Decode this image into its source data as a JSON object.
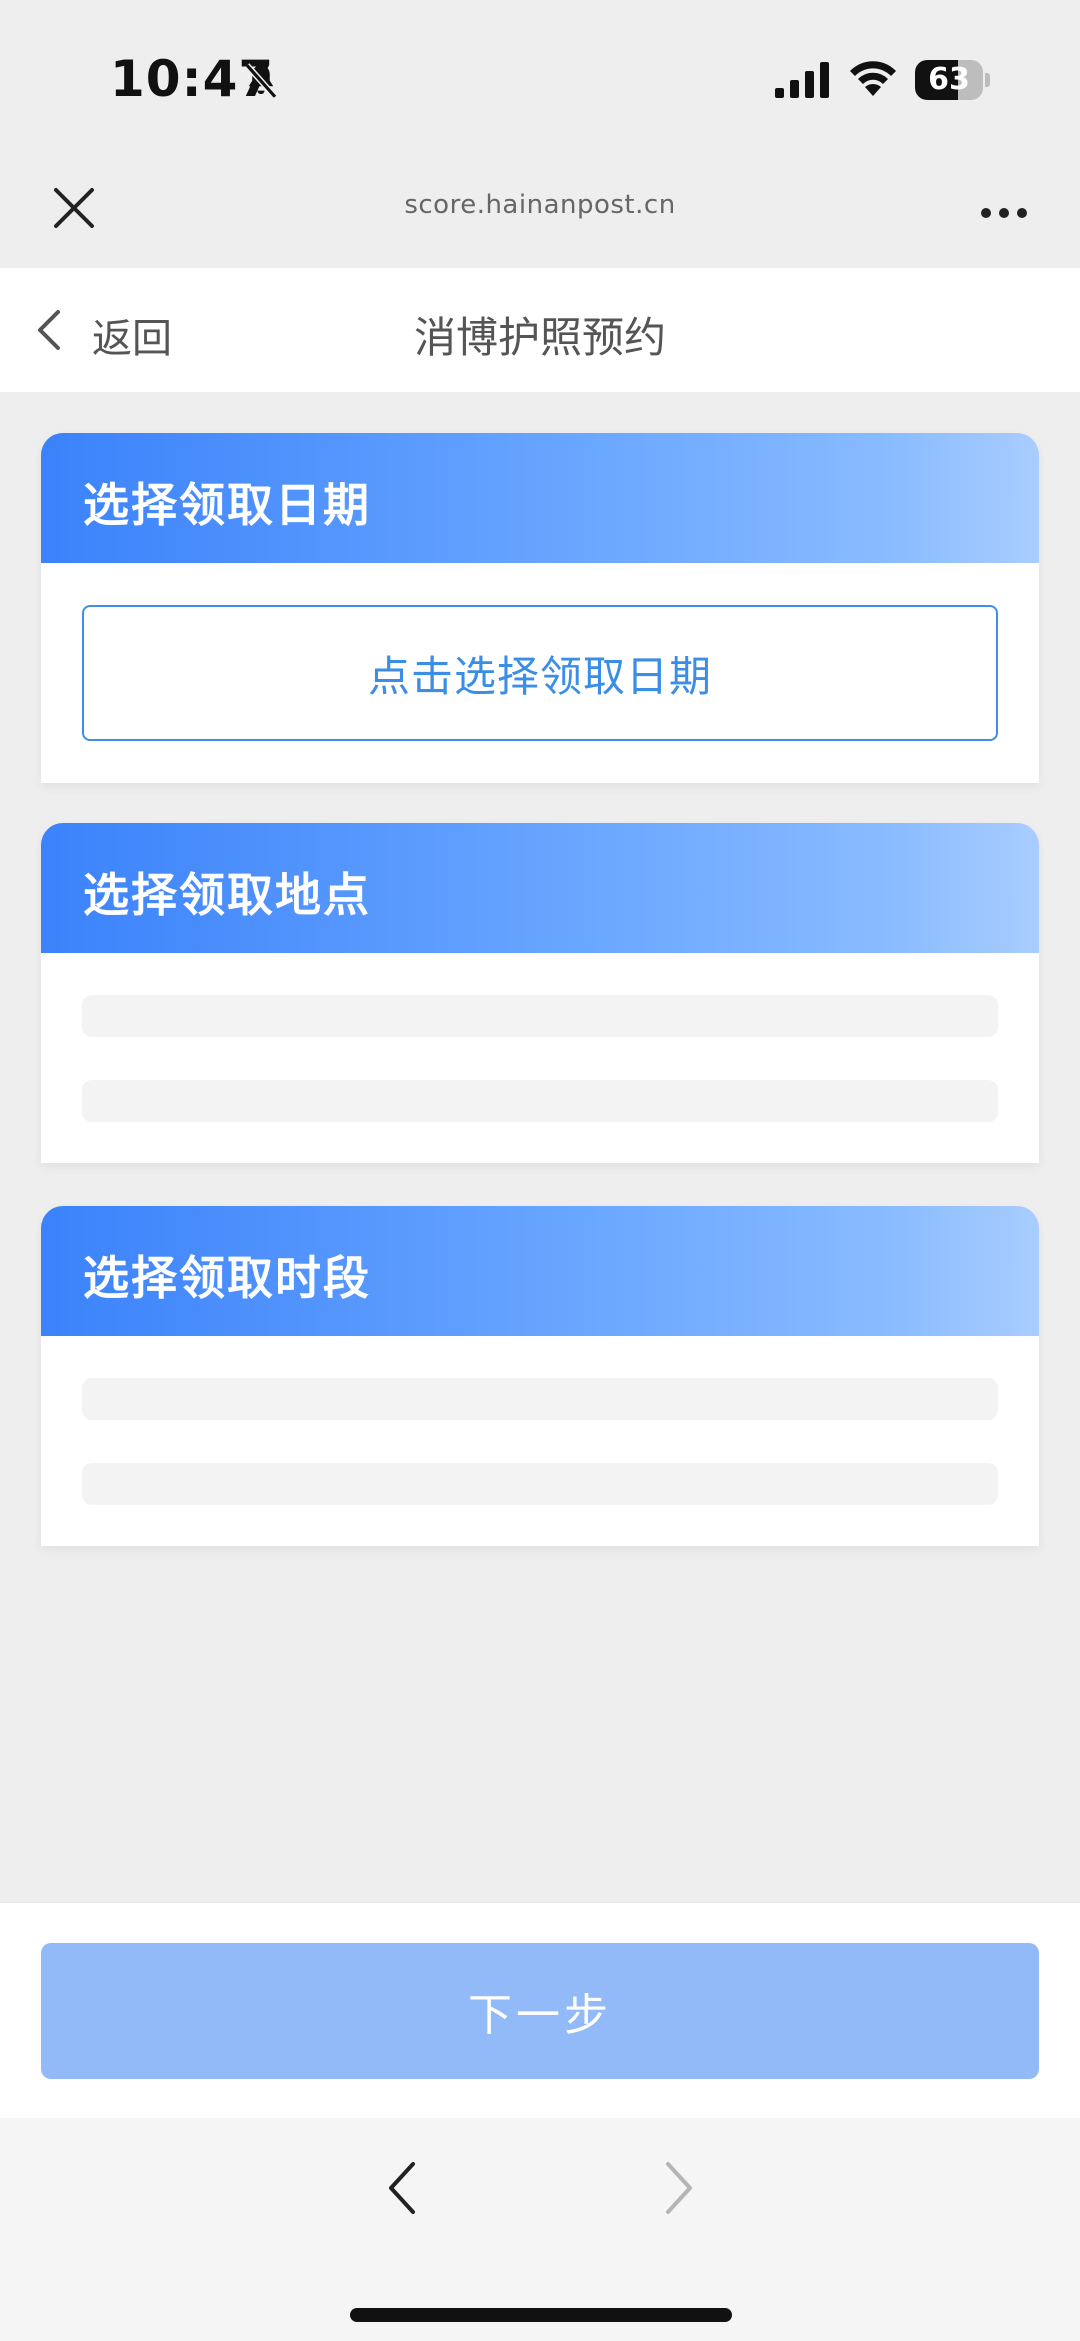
{
  "status_bar": {
    "time": "10:47",
    "battery_level": "63",
    "battery_fraction": 0.63,
    "icons": [
      "bell-muted-icon",
      "signal-icon",
      "wifi-icon",
      "battery-icon"
    ]
  },
  "browser": {
    "url": "score.hainanpost.cn",
    "icons": [
      "close-icon",
      "more-icon",
      "nav-back-icon",
      "nav-forward-icon"
    ]
  },
  "header": {
    "back_label": "返回",
    "title": "消博护照预约"
  },
  "sections": {
    "date": {
      "title": "选择领取日期",
      "button_label": "点击选择领取日期"
    },
    "location": {
      "title": "选择领取地点"
    },
    "timeslot": {
      "title": "选择领取时段"
    }
  },
  "footer": {
    "next_label": "下一步"
  },
  "colors": {
    "accent": "#3a8ee6",
    "header_gradient_start": "#3b82fb",
    "header_gradient_end": "#a9cdff",
    "next_button": "#93baf8",
    "page_background": "#eeeeee"
  }
}
